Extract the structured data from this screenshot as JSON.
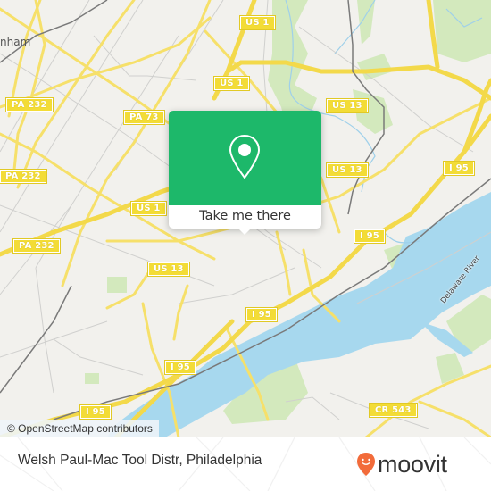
{
  "map": {
    "place_labels": [
      {
        "text": "nham"
      }
    ],
    "road_shields": [
      {
        "id": "us1-top",
        "text": "US 1"
      },
      {
        "id": "us1-mid",
        "text": "US 1"
      },
      {
        "id": "us1-left",
        "text": "US 1"
      },
      {
        "id": "pa232-a",
        "text": "PA 232"
      },
      {
        "id": "pa232-b",
        "text": "PA 232"
      },
      {
        "id": "pa232-c",
        "text": "PA 232"
      },
      {
        "id": "pa73",
        "text": "PA 73"
      },
      {
        "id": "us13-a",
        "text": "US 13"
      },
      {
        "id": "us13-b",
        "text": "US 13"
      },
      {
        "id": "us13-c",
        "text": "US 13"
      },
      {
        "id": "i95-a",
        "text": "I 95"
      },
      {
        "id": "i95-b",
        "text": "I 95"
      },
      {
        "id": "i95-c",
        "text": "I 95"
      },
      {
        "id": "i95-d",
        "text": "I 95"
      },
      {
        "id": "i95-e",
        "text": "I 95"
      },
      {
        "id": "cr543",
        "text": "CR 543"
      }
    ],
    "water_label": "Delaware River",
    "attribution": "© OpenStreetMap contributors",
    "colors": {
      "land": "#f2f1ed",
      "water": "#a7d8ee",
      "park": "#cfe8b4",
      "major_road": "#f6e06a",
      "minor_road": "#cfcfcf"
    }
  },
  "popup": {
    "icon": "map-pin-icon",
    "button_label": "Take me there",
    "color": "#1db86a"
  },
  "footer": {
    "title": "Welsh Paul-Mac Tool Distr, Philadelphia",
    "brand": "moovit",
    "brand_color": "#f26b3a"
  }
}
